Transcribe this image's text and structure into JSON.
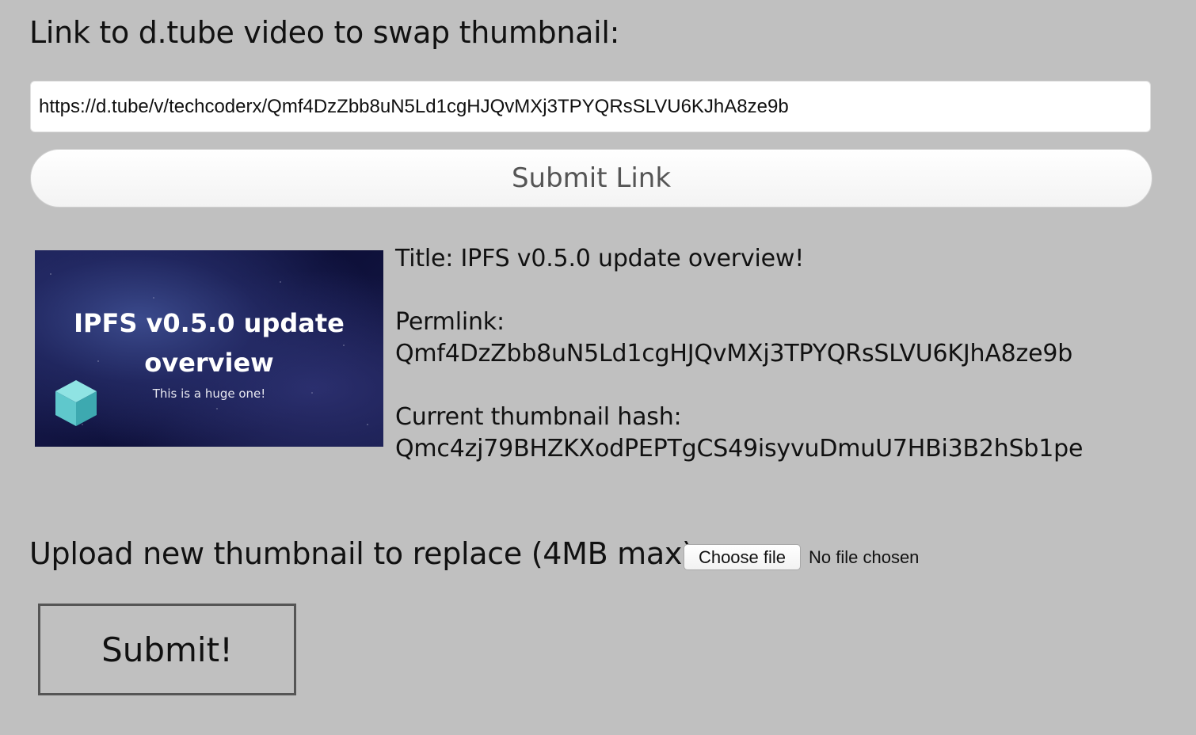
{
  "heading": "Link to d.tube video to swap thumbnail:",
  "link_input": {
    "value": "https://d.tube/v/techcoderx/Qmf4DzZbb8uN5Ld1cgHJQvMXj3TPYQRsSLVU6KJhA8ze9b"
  },
  "submit_link_label": "Submit Link",
  "thumbnail": {
    "title_line1": "IPFS v0.5.0 update",
    "title_line2": "overview",
    "subtitle": "This is a huge one!",
    "icon": "ipfs-cube-icon",
    "cube_color": "#5fc8cc"
  },
  "video_info": {
    "title_line": "Title: IPFS v0.5.0 update overview!",
    "permlink_label": "Permlink:",
    "permlink_value": "Qmf4DzZbb8uN5Ld1cgHJQvMXj3TPYQRsSLVU6KJhA8ze9b",
    "hash_label": "Current thumbnail hash:",
    "hash_value": "Qmc4zj79BHZKXodPEPTgCS49isyvuDmuU7HBi3B2hSb1pe"
  },
  "upload": {
    "label": "Upload new thumbnail to replace (4MB max):",
    "choose_file_label": "Choose file",
    "no_file_text": "No file chosen"
  },
  "submit_label": "Submit!",
  "colors": {
    "background": "#c0c0c0",
    "text": "#111111"
  }
}
